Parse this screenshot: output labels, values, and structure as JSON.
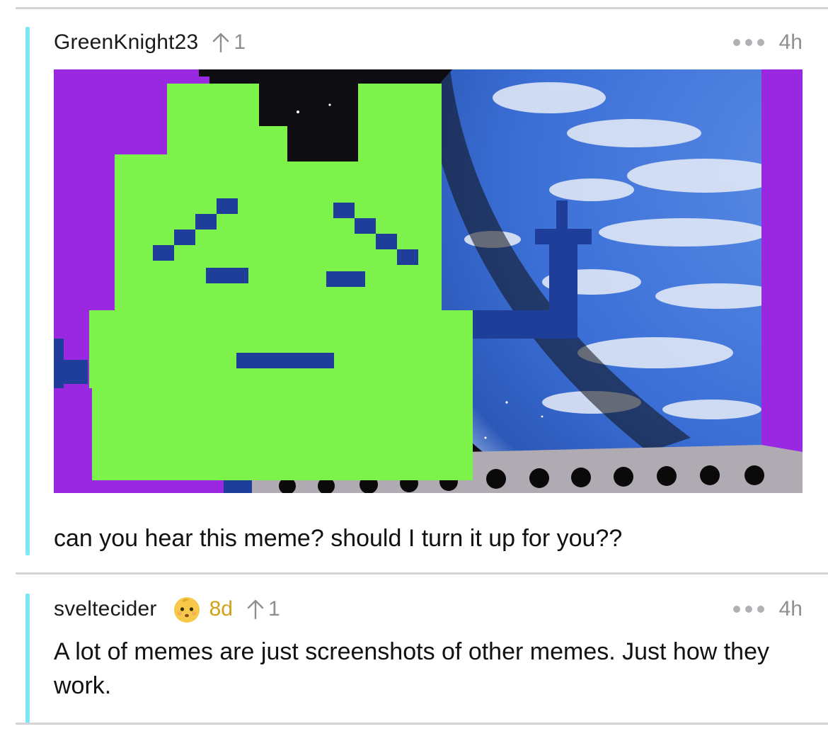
{
  "comments": [
    {
      "username": "GreenKnight23",
      "upvotes": "1",
      "timestamp": "4h",
      "more_icon": "ellipsis-icon",
      "attachment": {
        "type": "image",
        "subject": "green-pixel-face-over-earth-from-space",
        "colors": {
          "face": "#7cf24a",
          "features": "#1e3e9a",
          "frame": "#9a28e0",
          "space": "#0e0e12"
        }
      },
      "body": "can you hear this meme? should I turn it up for you??"
    },
    {
      "username": "sveltecider",
      "flair_icon": "baby-face-emoji-icon",
      "account_age": "8d",
      "upvotes": "1",
      "timestamp": "4h",
      "more_icon": "ellipsis-icon",
      "body": "A lot of memes are just screenshots of other memes. Just how they work."
    }
  ],
  "colors": {
    "thread_line": "#7ee7f5",
    "divider": "#d4d4d8",
    "meta_gray": "#8e8e93",
    "account_age": "#d4a017",
    "text": "#111111"
  }
}
